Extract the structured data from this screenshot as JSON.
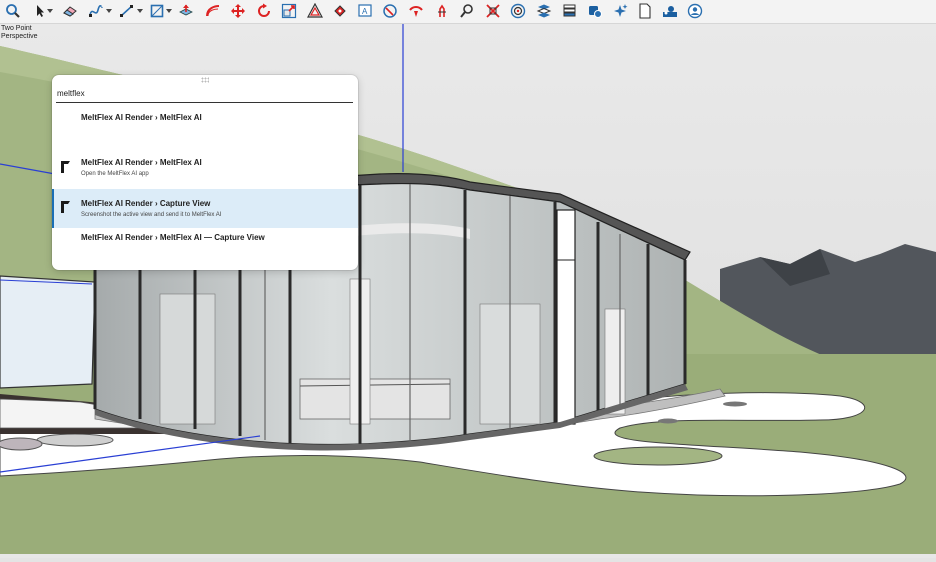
{
  "toolbar": {
    "tools": [
      "zoom-icon",
      "select-icon",
      "eraser-icon",
      "freehand-icon",
      "line-icon",
      "rectangle-icon",
      "push-pull-icon",
      "follow-me-icon",
      "move-icon",
      "rotate-icon",
      "scale-icon",
      "offset-icon",
      "paint-bucket-icon",
      "text-icon",
      "orbit-icon",
      "pan-icon",
      "walk-icon",
      "search-icon",
      "zoom-extents-icon",
      "target-icon",
      "layers-icon",
      "styles-icon",
      "components-icon",
      "ai-sparkle-icon",
      "page-icon",
      "profile-icon",
      "account-icon"
    ]
  },
  "viewport": {
    "camera_label_line1": "Two Point",
    "camera_label_line2": "Perspective",
    "colors": {
      "sky": "#e6e6e6",
      "grass": "#a2b482",
      "path": "#ffffff",
      "glass": "#c9cfd0",
      "axis_blue": "#2a3fd4"
    }
  },
  "palette": {
    "search_value": "meltflex",
    "items": [
      {
        "title": "MeltFlex AI Render › MeltFlex AI",
        "subtitle": "",
        "icon": ""
      },
      {
        "title": "MeltFlex AI Render › MeltFlex AI",
        "subtitle": "Open the MeltFlex AI app",
        "icon": "meltflex-logo-icon"
      },
      {
        "title": "MeltFlex AI Render › Capture View",
        "subtitle": "Screenshot the active view and send it to MeltFlex AI",
        "icon": "meltflex-logo-icon",
        "selected": true
      },
      {
        "title": "MeltFlex AI Render › MeltFlex AI — Capture View",
        "subtitle": "",
        "icon": ""
      }
    ],
    "selection_color": "#dcecf8",
    "accent_color": "#1b6fb5"
  }
}
